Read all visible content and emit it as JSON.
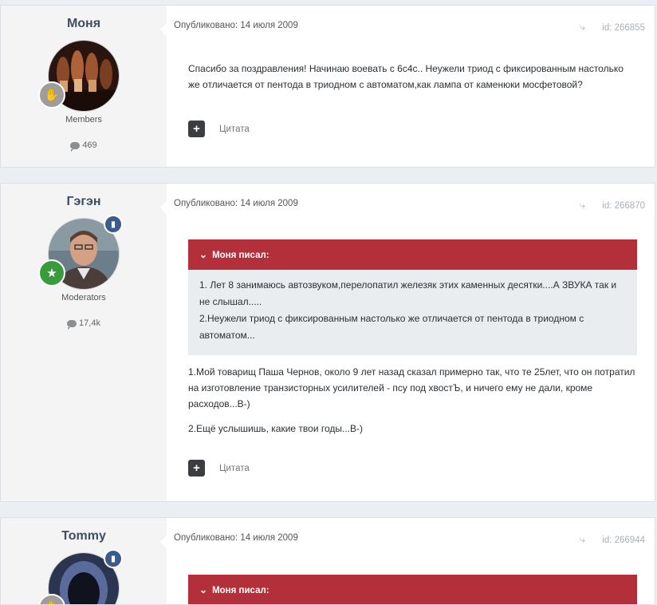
{
  "posts": [
    {
      "author": "Моня",
      "group": "Members",
      "post_count": "469",
      "published_label": "Опубликовано:",
      "date": "14 июля 2009",
      "id": "id: 266855",
      "text": "Спасибо за поздравления! Начинаю воевать с 6с4с.. Неужели триод с фиксированным настолько же отличается от пентода в триодном с автоматом,как лампа от каменюки мосфетовой?",
      "quote_label": "Цитата"
    },
    {
      "author": "Гэгэн",
      "group": "Moderators",
      "post_count": "17,4k",
      "published_label": "Опубликовано:",
      "date": "14 июля 2009",
      "id": "id: 266870",
      "quote_author": "Моня писал:",
      "quote_lines": [
        "1. Лет 8 занимаюсь автозвуком,перелопатил железяк этих каменных десятки....А ЗВУКА так и не слышал.....",
        "2.Неужели триод с фиксированным настолько же отличается от пентода в триодном с автоматом..."
      ],
      "paragraphs": [
        "1.Мой товарищ Паша Чернов, около 9 лет назад сказал примерно так, что те 25лет, что он потратил на изготовление транзисторных усилителей - псу под хвостЪ, и ничего ему не дали, кроме расходов...В-)",
        "2.Ещё услышишь, какие твои годы...В-)"
      ],
      "quote_label": "Цитата"
    },
    {
      "author": "Tommy",
      "published_label": "Опубликовано:",
      "date": "14 июля 2009",
      "id": "id: 266944",
      "quote_author": "Моня писал:"
    }
  ],
  "icons": {
    "share": "share-icon",
    "plus": "plus-icon",
    "post_count": "comment-bubble-icon",
    "rank": "badge-icon",
    "moderator": "shield-icon"
  },
  "colors": {
    "quote_header": "#b3303b",
    "quote_body": "#eaedf0",
    "author_name": "#3d4e63",
    "moderator_badge": "#3c5b8d"
  }
}
